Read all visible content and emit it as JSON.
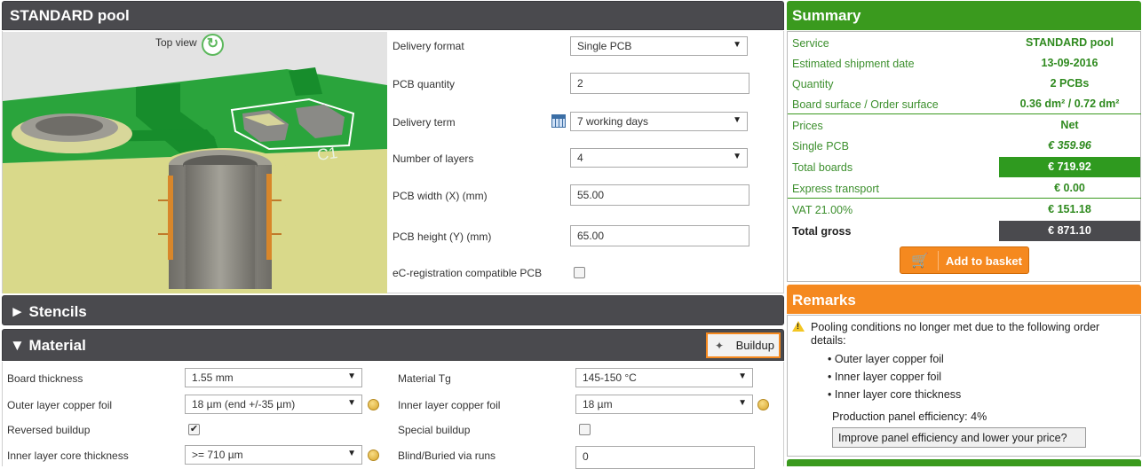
{
  "std_pool": {
    "title": "STANDARD pool",
    "top_view": "Top view",
    "delivery_format_label": "Delivery format",
    "delivery_format_value": "Single PCB",
    "pcb_quantity_label": "PCB quantity",
    "pcb_quantity_value": "2",
    "delivery_term_label": "Delivery term",
    "delivery_term_value": "7 working days",
    "layers_label": "Number of layers",
    "layers_value": "4",
    "width_label": "PCB width (X) (mm)",
    "width_value": "55.00",
    "height_label": "PCB height (Y) (mm)",
    "height_value": "65.00",
    "ec_label": "eC-registration compatible PCB"
  },
  "stencils": {
    "title": "► Stencils"
  },
  "material": {
    "title": "▼ Material",
    "buildup_button": "Buildup",
    "board_thickness_label": "Board thickness",
    "board_thickness_value": "1.55 mm",
    "outer_copper_label": "Outer layer copper foil",
    "outer_copper_value": "18 µm (end +/-35 µm)",
    "reversed_label": "Reversed buildup",
    "inner_core_label": "Inner layer core thickness",
    "inner_core_value": ">= 710 µm",
    "tg_label": "Material Tg",
    "tg_value": "145-150 °C",
    "inner_copper_label": "Inner layer copper foil",
    "inner_copper_value": "18 µm",
    "special_label": "Special buildup",
    "blind_label": "Blind/Buried via runs",
    "blind_value": "0"
  },
  "summary": {
    "title": "Summary",
    "rows": [
      {
        "k": "Service",
        "v": "STANDARD pool"
      },
      {
        "k": "Estimated shipment date",
        "v": "13-09-2016"
      },
      {
        "k": "Quantity",
        "v": "2 PCBs"
      },
      {
        "k": "Board surface / Order surface",
        "v": "0.36 dm² / 0.72 dm²"
      },
      {
        "k": "Prices",
        "v": "Net"
      },
      {
        "k": "Single PCB",
        "v": "€ 359.96"
      },
      {
        "k": "Total boards",
        "v": "€ 719.92"
      },
      {
        "k": "Express transport",
        "v": "€ 0.00"
      },
      {
        "k": "VAT 21.00%",
        "v": "€ 151.18"
      },
      {
        "k": "Total gross",
        "v": "€ 871.10"
      }
    ],
    "add_to_basket": "Add to basket"
  },
  "remarks": {
    "title": "Remarks",
    "message": "Pooling conditions no longer met due to the following order details:",
    "items": [
      "Outer layer copper foil",
      "Inner layer copper foil",
      "Inner layer core thickness"
    ],
    "efficiency": "Production panel efficiency: 4%",
    "improve_button": "Improve panel efficiency and lower your price?"
  },
  "colors": {
    "accent_green": "#3a9a1e",
    "accent_orange": "#f5891f",
    "header_dark": "#4a4a4e"
  },
  "icons": [
    "refresh-icon",
    "calendar-icon",
    "cart-icon",
    "wand-icon",
    "warning-icon",
    "coin-icon"
  ]
}
